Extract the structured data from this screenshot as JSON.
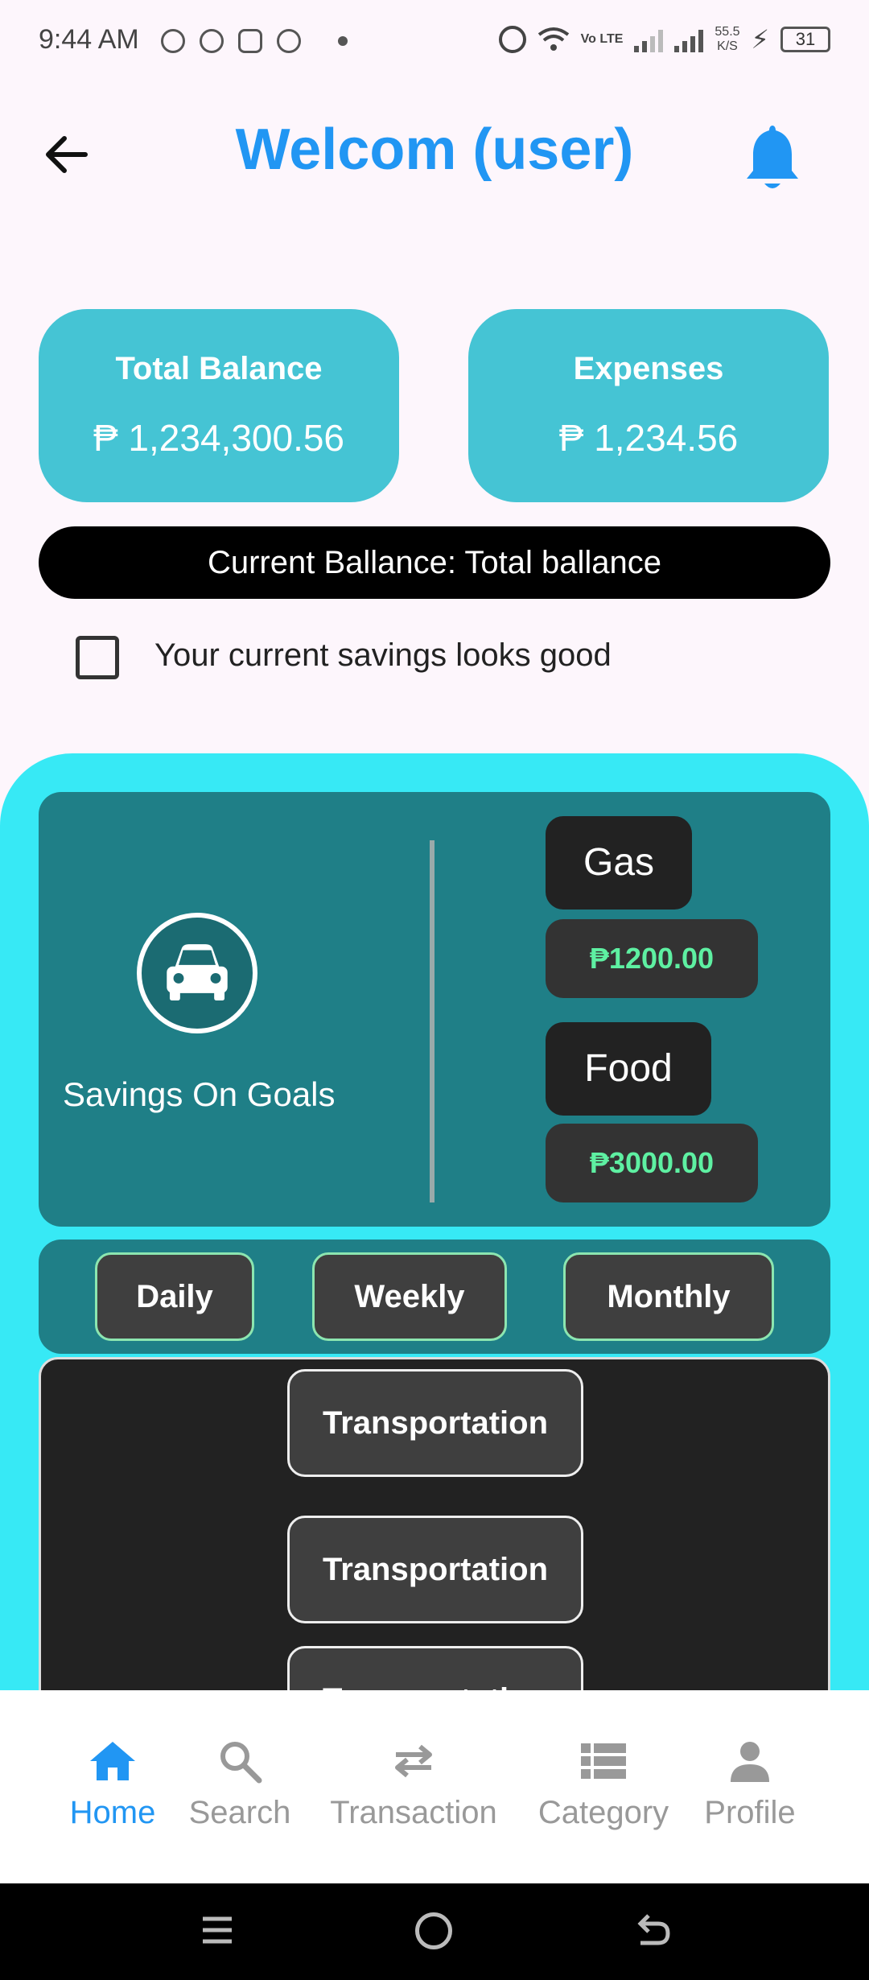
{
  "status_bar": {
    "time": "9:44 AM",
    "lte": "Vo LTE",
    "speed_value": "55.5",
    "speed_unit": "K/S",
    "battery": "31"
  },
  "header": {
    "title": "Welcom (user)"
  },
  "summary": {
    "total_balance": {
      "title": "Total Balance",
      "value": "₱ 1,234,300.56"
    },
    "expenses": {
      "title": "Expenses",
      "value": "₱ 1,234.56"
    }
  },
  "current_balance_label": "Current Ballance: Total ballance",
  "savings_check_label": "Your current savings looks good",
  "goals": {
    "label": "Savings On Goals",
    "items": [
      {
        "name": "Gas",
        "amount": "₱1200.00"
      },
      {
        "name": "Food",
        "amount": "₱3000.00"
      }
    ]
  },
  "periods": [
    "Daily",
    "Weekly",
    "Monthly"
  ],
  "transactions": [
    "Transportation",
    "Transportation",
    "Transportation"
  ],
  "bottom_nav": [
    {
      "label": "Home",
      "icon": "home-icon",
      "active": true
    },
    {
      "label": "Search",
      "icon": "search-icon",
      "active": false
    },
    {
      "label": "Transaction",
      "icon": "swap-icon",
      "active": false
    },
    {
      "label": "Category",
      "icon": "list-icon",
      "active": false
    },
    {
      "label": "Profile",
      "icon": "person-icon",
      "active": false
    }
  ],
  "colors": {
    "accent": "#2196f3",
    "card": "#45c4d4",
    "panel": "#37e9f5",
    "goals_card": "#1f7f87",
    "amount_text": "#5ef0a2"
  }
}
